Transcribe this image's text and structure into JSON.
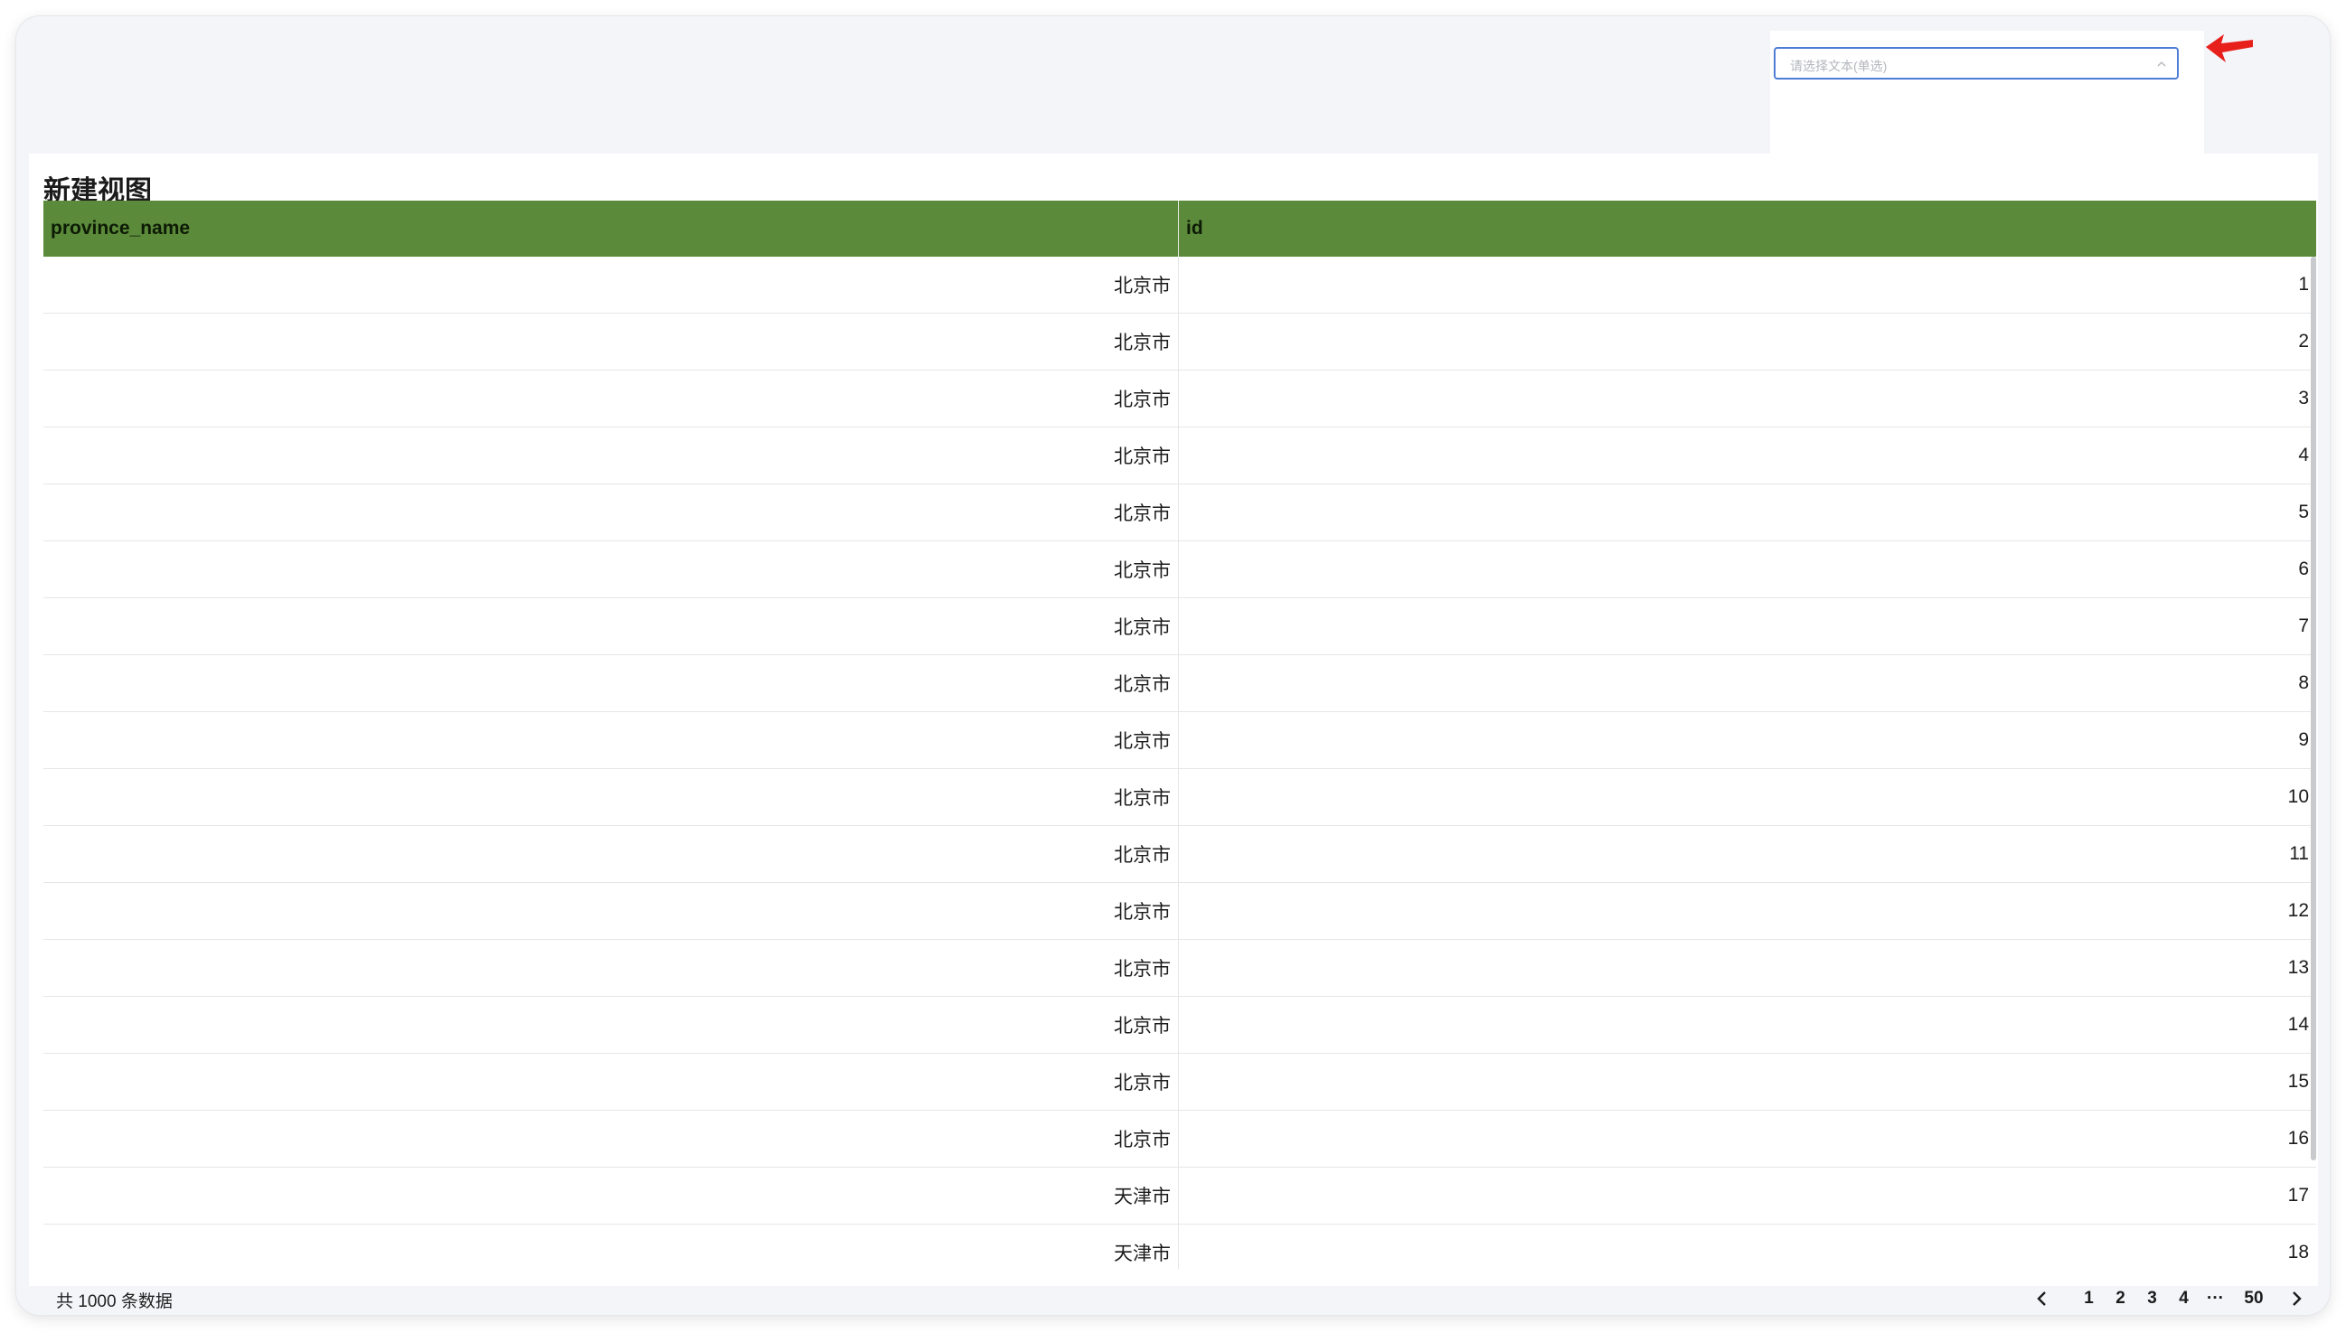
{
  "filter": {
    "placeholder": "请选择文本(单选)"
  },
  "view": {
    "title": "新建视图"
  },
  "table": {
    "columns": [
      "province_name",
      "id"
    ],
    "rows": [
      {
        "province_name": "北京市",
        "id": "1"
      },
      {
        "province_name": "北京市",
        "id": "2"
      },
      {
        "province_name": "北京市",
        "id": "3"
      },
      {
        "province_name": "北京市",
        "id": "4"
      },
      {
        "province_name": "北京市",
        "id": "5"
      },
      {
        "province_name": "北京市",
        "id": "6"
      },
      {
        "province_name": "北京市",
        "id": "7"
      },
      {
        "province_name": "北京市",
        "id": "8"
      },
      {
        "province_name": "北京市",
        "id": "9"
      },
      {
        "province_name": "北京市",
        "id": "10"
      },
      {
        "province_name": "北京市",
        "id": "11"
      },
      {
        "province_name": "北京市",
        "id": "12"
      },
      {
        "province_name": "北京市",
        "id": "13"
      },
      {
        "province_name": "北京市",
        "id": "14"
      },
      {
        "province_name": "北京市",
        "id": "15"
      },
      {
        "province_name": "北京市",
        "id": "16"
      },
      {
        "province_name": "天津市",
        "id": "17"
      },
      {
        "province_name": "天津市",
        "id": "18"
      }
    ]
  },
  "footer": {
    "total_text": "共 1000 条数据",
    "pages": [
      "1",
      "2",
      "3",
      "4",
      "···",
      "50"
    ]
  },
  "colors": {
    "header_bg": "#5b8a3a",
    "select_border": "#4f7dd6",
    "annotation_arrow": "#e8201c"
  },
  "icons": {
    "select": "chevron-up-icon",
    "pager_prev": "chevron-left-icon",
    "pager_next": "chevron-right-icon",
    "annotation": "red-arrow-icon"
  }
}
